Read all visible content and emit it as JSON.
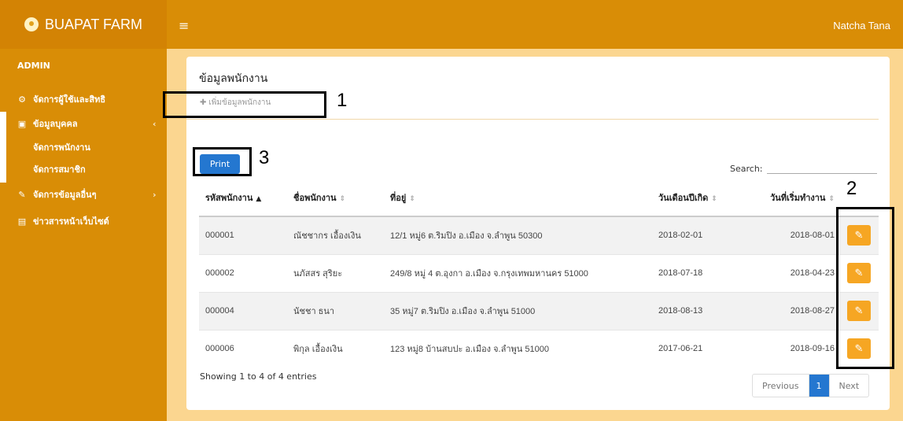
{
  "brand": {
    "name": "BUAPAT FARM",
    "logo_icon": "chick-icon"
  },
  "header": {
    "menu_icon": "≡",
    "user": "Natcha Tana"
  },
  "sidebar": {
    "section": "ADMIN",
    "items": [
      {
        "label": "จัดการผู้ใช้และสิทธิ",
        "icon": "⚙",
        "chevron": ""
      },
      {
        "label": "ข้อมูลบุคคล",
        "icon": "▣",
        "chevron": "‹"
      },
      {
        "label": "จัดการข้อมูลอื่นๆ",
        "icon": "✎",
        "chevron": "›"
      },
      {
        "label": "ข่าวสารหน้าเว็บไซต์",
        "icon": "▤",
        "chevron": ""
      }
    ],
    "sub_items": [
      "จัดการพนักงาน",
      "จัดการสมาชิก"
    ]
  },
  "main": {
    "title": "ข้อมูลพนักงาน",
    "add_label": "เพิ่มข้อมูลพนักงาน",
    "print_label": "Print",
    "search_label": "Search:",
    "search_value": "",
    "columns": [
      "รหัสพนักงาน",
      "ชื่อพนักงาน",
      "ที่อยู่",
      "วันเดือนปีเกิด",
      "วันที่เริ่มทำงาน"
    ],
    "rows": [
      {
        "id": "000001",
        "name": "ณัชชากร เอื้องเงิน",
        "address": "12/1 หมู่6 ต.ริมปิง อ.เมือง จ.ลำพูน 50300",
        "dob": "2018-02-01",
        "start": "2018-08-01"
      },
      {
        "id": "000002",
        "name": "นภัสสร สุริยะ",
        "address": "249/8 หมู่ 4 ต.อุงกา อ.เมือง จ.กรุงเทพมหานคร 51000",
        "dob": "2018-07-18",
        "start": "2018-04-23"
      },
      {
        "id": "000004",
        "name": "นัชชา ธนา",
        "address": "35 หมู่7 ต.ริมปิง อ.เมือง จ.ลำพูน 51000",
        "dob": "2018-08-13",
        "start": "2018-08-27"
      },
      {
        "id": "000006",
        "name": "พิกุล เอื้องเงิน",
        "address": "123 หมู่8 บ้านสบปะ อ.เมือง จ.ลำพูน 51000",
        "dob": "2017-06-21",
        "start": "2018-09-16"
      }
    ],
    "info": "Showing 1 to 4 of 4 entries",
    "pagination": {
      "previous": "Previous",
      "current": "1",
      "next": "Next"
    }
  },
  "annotations": [
    "1",
    "2",
    "3"
  ],
  "colors": {
    "topbar": "#d98d06",
    "sidebar": "#d98d06",
    "background": "#fbd690",
    "primary": "#2477d0",
    "edit": "#f6a623"
  }
}
